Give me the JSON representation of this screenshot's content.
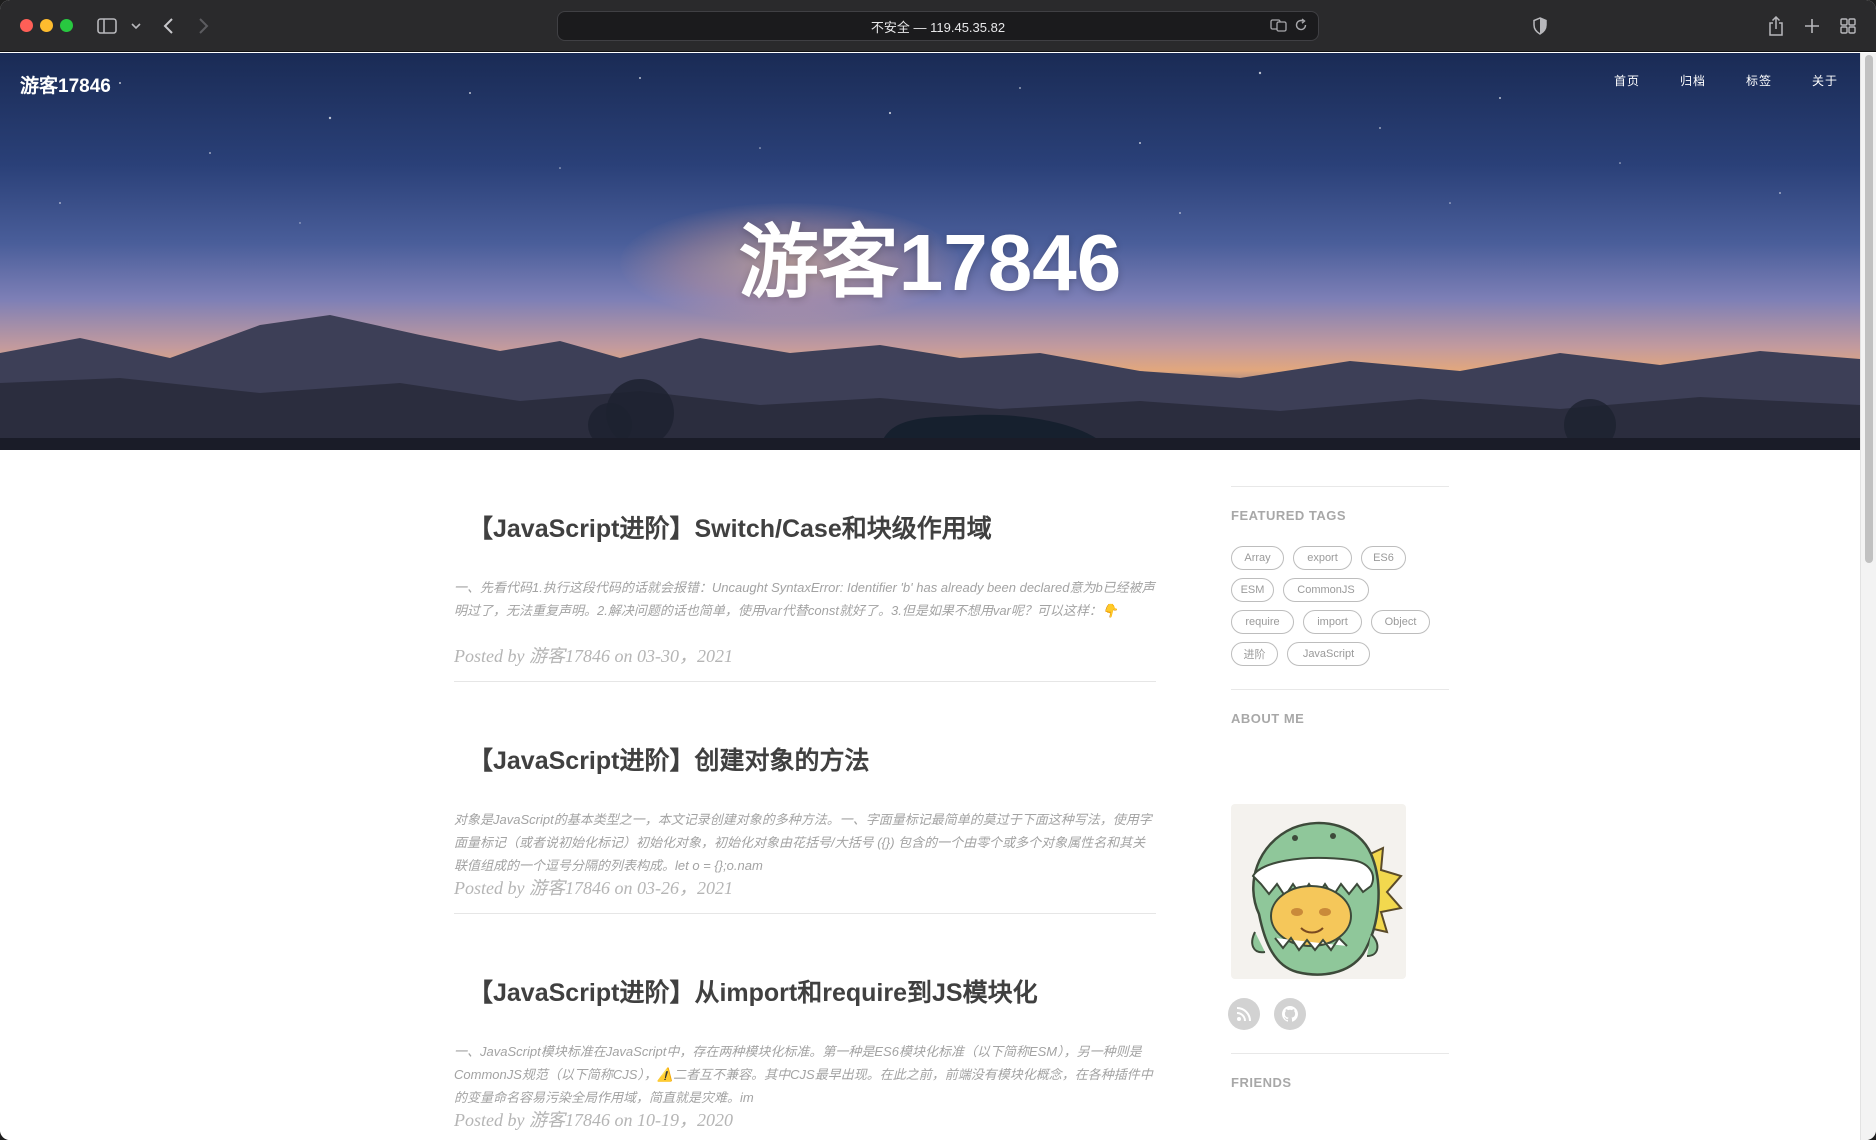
{
  "browser": {
    "address": "不安全 — 119.45.35.82",
    "icons": [
      "sidebar-icon",
      "chevron-down-icon",
      "back-icon",
      "forward-icon",
      "translate-icon",
      "reload-icon",
      "shield-icon",
      "share-icon",
      "new-tab-icon",
      "tab-overview-icon"
    ]
  },
  "site": {
    "brand": "游客17846",
    "hero_title": "游客17846",
    "nav": [
      "首页",
      "归档",
      "标签",
      "关于"
    ]
  },
  "posts": [
    {
      "title": "【JavaScript进阶】Switch/Case和块级作用域",
      "excerpt": "一、先看代码1.执行这段代码的话就会报错：Uncaught SyntaxError: Identifier 'b' has already been declared意为b已经被声明过了，无法重复声明。2.解决问题的话也简单，使用var代替const就好了。3.但是如果不想用var呢？可以这样：👇",
      "meta": "Posted by 游客17846 on 03-30，2021"
    },
    {
      "title": "【JavaScript进阶】创建对象的方法",
      "excerpt": "对象是JavaScript的基本类型之一，本文记录创建对象的多种方法。一、字面量标记最简单的莫过于下面这种写法，使用字面量标记（或者说初始化标记）初始化对象，初始化对象由花括号/大括号 ({}) 包含的一个由零个或多个对象属性名和其关联值组成的一个逗号分隔的列表构成。let o = {};o.nam",
      "meta": "Posted by 游客17846 on 03-26，2021"
    },
    {
      "title": "【JavaScript进阶】从import和require到JS模块化",
      "excerpt": "一、JavaScript模块标准在JavaScript中，存在两种模块化标准。第一种是ES6模块化标准（以下简称ESM），另一种则是CommonJS规范（以下简称CJS），⚠️二者互不兼容。其中CJS最早出现。在此之前，前端没有模块化概念，在各种插件中的变量命名容易污染全局作用域，简直就是灾难。im",
      "meta": "Posted by 游客17846 on 10-19，2020"
    }
  ],
  "sidebar": {
    "featured_heading": "FEATURED TAGS",
    "tags": [
      "Array",
      "export",
      "ES6",
      "ESM",
      "CommonJS",
      "require",
      "import",
      "Object",
      "进阶",
      "JavaScript"
    ],
    "about_heading": "ABOUT ME",
    "social": [
      "rss-icon",
      "github-icon"
    ],
    "friends_heading": "FRIENDS"
  },
  "colors": {
    "title_text": "#404040",
    "muted_text": "#a3a3a3",
    "tag_border": "#bdbdbd",
    "hero_sky": "#2a4078",
    "hero_sunset": "#e2a77d"
  }
}
